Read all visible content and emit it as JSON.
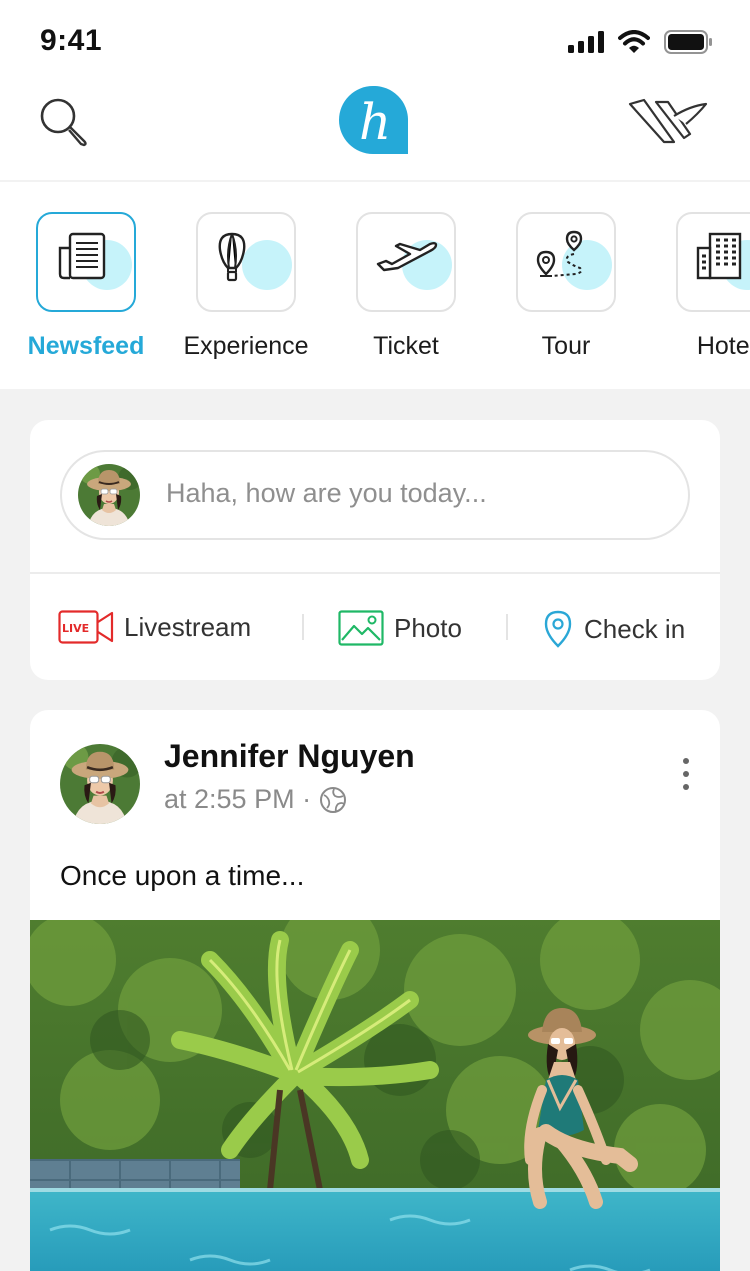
{
  "status_bar": {
    "time": "9:41",
    "icons": [
      "signal-icon",
      "wifi-icon",
      "battery-icon"
    ]
  },
  "header": {
    "left_icon": "search-icon",
    "logo_letter": "h",
    "right_icon": "plane-logo-icon"
  },
  "colors": {
    "accent": "#25a9d8",
    "icon_blob": "#c6f3fa",
    "live_red": "#e32a2a",
    "photo_green": "#1fb866",
    "checkin_blue": "#2aa7d6"
  },
  "categories": [
    {
      "label": "Newsfeed",
      "icon": "newspaper-icon",
      "active": true
    },
    {
      "label": "Experience",
      "icon": "hot-air-balloon-icon",
      "active": false
    },
    {
      "label": "Ticket",
      "icon": "airplane-icon",
      "active": false
    },
    {
      "label": "Tour",
      "icon": "route-map-icon",
      "active": false
    },
    {
      "label": "Hotel",
      "icon": "hotel-building-icon",
      "active": false
    }
  ],
  "composer": {
    "placeholder": "Haha, how are you today...",
    "actions": [
      {
        "label": "Livestream",
        "icon": "live-camera-icon",
        "badge": "LIVE"
      },
      {
        "label": "Photo",
        "icon": "photo-icon"
      },
      {
        "label": "Check in",
        "icon": "location-pin-icon"
      }
    ]
  },
  "post": {
    "author": "Jennifer Nguyen",
    "time": "at 2:55 PM ·",
    "privacy_icon": "globe-icon",
    "text": "Once upon a time..."
  }
}
